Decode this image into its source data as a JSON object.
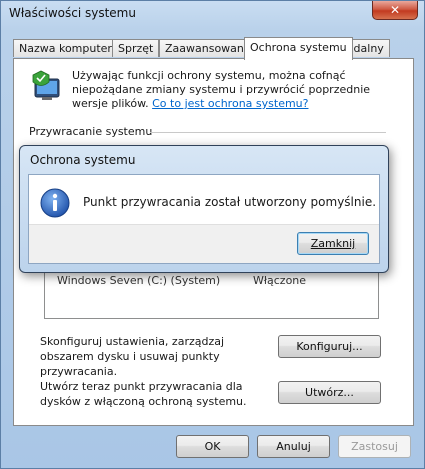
{
  "window": {
    "title": "Właściwości systemu",
    "close_glyph": "✕"
  },
  "tabs": [
    {
      "label": "Nazwa komputera"
    },
    {
      "label": "Sprzęt"
    },
    {
      "label": "Zaawansowane"
    },
    {
      "label": "Ochrona systemu",
      "active": true
    },
    {
      "label": "Zdalny"
    }
  ],
  "panel": {
    "intro_text": "Używając funkcji ochrony systemu, można cofnąć niepożądane zmiany systemu i przywrócić poprzednie wersje plików. ",
    "intro_link": "Co to jest ochrona systemu?",
    "restore_section": "Przywracanie systemu",
    "drive_row": {
      "name": "Windows Seven (C:) (System)",
      "status": "Włączone"
    },
    "configure_text": "Skonfiguruj ustawienia, zarządzaj obszarem dysku i usuwaj punkty przywracania.",
    "configure_button": "Konfiguruj...",
    "create_text": "Utwórz teraz punkt przywracania dla dysków z włączoną ochroną systemu.",
    "create_button": "Utwórz..."
  },
  "footer": {
    "ok": "OK",
    "cancel": "Anuluj",
    "apply": "Zastosuj"
  },
  "dialog": {
    "title": "Ochrona systemu",
    "message": "Punkt przywracania został utworzony pomyślnie.",
    "close_button": "Zamknij",
    "icon": "info-icon"
  },
  "colors": {
    "accent_blue": "#2a6fc9",
    "link": "#0066cc",
    "close_red": "#c23a20"
  }
}
